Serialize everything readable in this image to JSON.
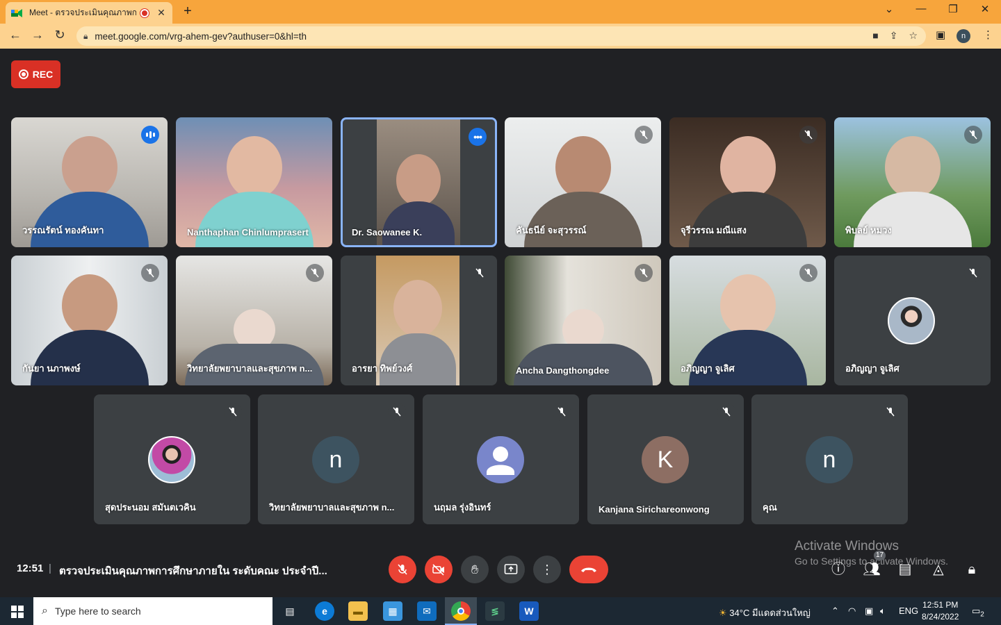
{
  "browser": {
    "tab_title": "Meet - ตรวจประเมินคุณภาพการ",
    "new_tab": "+",
    "url": "meet.google.com/vrg-ahem-gev?authuser=0&hl=th",
    "profile_initial": "n",
    "window_controls": [
      "⌄",
      "—",
      "❐",
      "✕"
    ]
  },
  "meet": {
    "rec_label": "REC",
    "participants": [
      {
        "name": "วรรณรัตน์ ทองคันทา",
        "state": "speaking"
      },
      {
        "name": "Nanthaphan Chinlumprasert",
        "state": "none"
      },
      {
        "name": "Dr. Saowanee K.",
        "state": "pinned-menu"
      },
      {
        "name": "คันธนีย์ จะสุวรรณ์",
        "state": "muted"
      },
      {
        "name": "จุรีวรรณ มณีแสง",
        "state": "muted"
      },
      {
        "name": "พิบลย์ หมวง",
        "state": "muted"
      },
      {
        "name": "กันยา นภาพงษ์",
        "state": "muted"
      },
      {
        "name": "วิทยาลัยพยาบาลและสุขภาพ n...",
        "state": "muted"
      },
      {
        "name": "อารยา ทิพย์วงศ์",
        "state": "muted"
      },
      {
        "name": "Ancha Dangthongdee",
        "state": "muted"
      },
      {
        "name": "อภิญญา จูเลิศ",
        "state": "muted"
      },
      {
        "name": "อภิญญา จูเลิศ",
        "state": "muted"
      },
      {
        "name": "สุดประนอม สมันตเวคิน",
        "state": "muted"
      },
      {
        "name": "วิทยาลัยพยาบาลและสุขภาพ n...",
        "state": "muted",
        "initial": "n"
      },
      {
        "name": "นฤมล รุ่งอินทร์",
        "state": "muted"
      },
      {
        "name": "Kanjana Sirichareonwong",
        "state": "muted",
        "initial": "K"
      },
      {
        "name": "คุณ",
        "state": "muted",
        "initial": "n"
      }
    ],
    "clock": "12:51",
    "separator": "|",
    "meeting_title": "ตรวจประเมินคุณภาพการศึกษาภายใน ระดับคณะ ประจำปี...",
    "people_count": "17",
    "colors": {
      "accent": "#1a73e8",
      "danger": "#ea4335",
      "tile": "#3c4043",
      "bg": "#202124"
    }
  },
  "watermark": {
    "line1": "Activate Windows",
    "line2": "Go to Settings to activate Windows."
  },
  "taskbar": {
    "search_placeholder": "Type here to search",
    "weather": "34°C  มีแดดส่วนใหญ่",
    "language": "ENG",
    "time": "12:51 PM",
    "date": "8/24/2022",
    "notification_count": "2"
  }
}
